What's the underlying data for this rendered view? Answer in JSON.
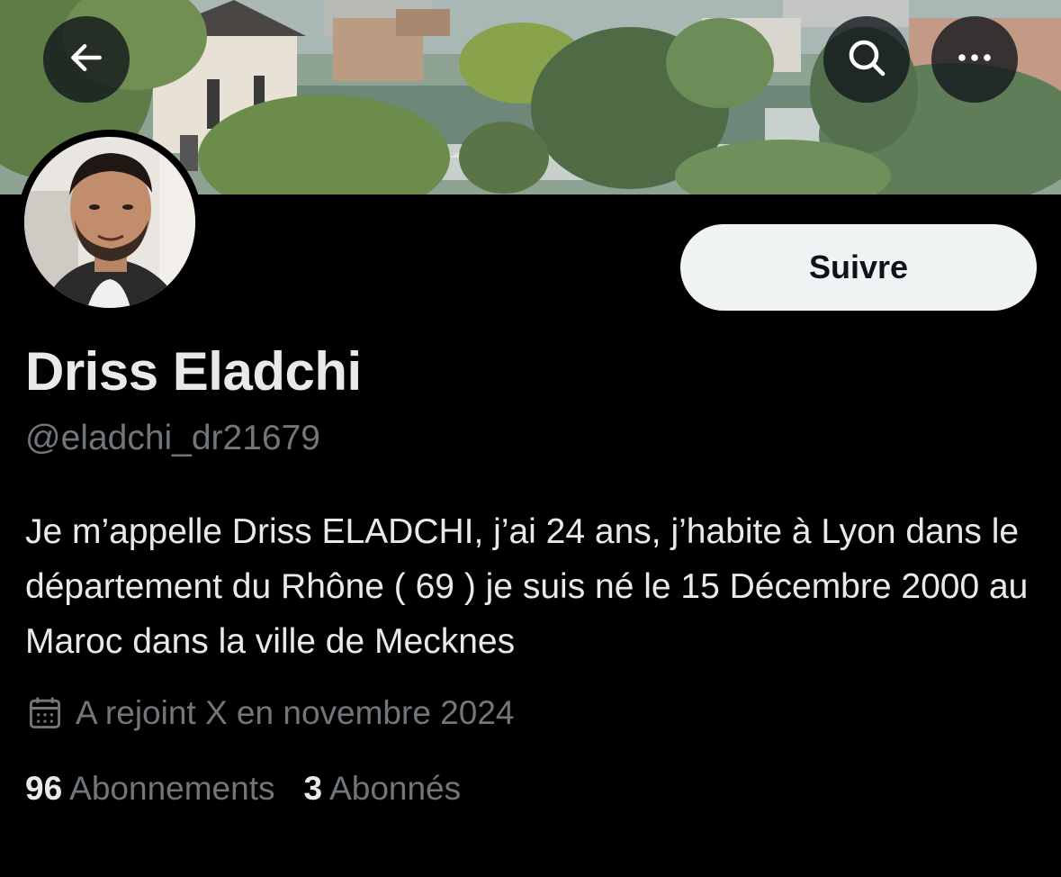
{
  "header": {
    "back_icon": "arrow-left-icon",
    "search_icon": "search-icon",
    "more_icon": "more-horizontal-icon"
  },
  "profile": {
    "display_name": "Driss Eladchi",
    "handle": "@eladchi_dr21679",
    "follow_label": "Suivre",
    "bio": "Je m’appelle Driss ELADCHI, j’ai 24 ans, j’habite à Lyon dans le département du Rhône ( 69 ) je suis né le 15 Décembre 2000 au Maroc dans la ville de Mecknes",
    "joined_icon": "calendar-icon",
    "joined": "A rejoint X en novembre 2024",
    "stats": {
      "following_count": "96",
      "following_label": "Abonnements",
      "followers_count": "3",
      "followers_label": "Abonnés"
    }
  },
  "colors": {
    "background": "#000000",
    "text_primary": "#e7e9ea",
    "text_secondary": "#71767b",
    "button_bg": "#eff3f4",
    "button_text": "#0f1419"
  }
}
